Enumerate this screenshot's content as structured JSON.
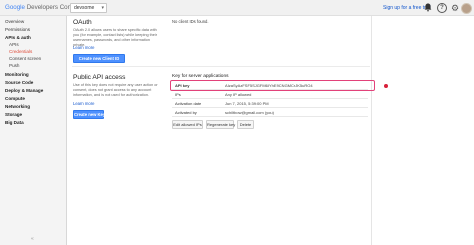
{
  "topbar": {
    "logo": {
      "brand": "Google",
      "product": "Developers Console"
    },
    "project": "devsome",
    "signup": "Sign up for a free trial",
    "icons": [
      "notifications-icon",
      "help-icon",
      "gear-icon",
      "avatar"
    ]
  },
  "sidebar": {
    "items": [
      {
        "label": "Overview"
      },
      {
        "label": "Permissions"
      },
      {
        "label": "APIs & auth"
      },
      {
        "label": "APIs"
      },
      {
        "label": "Credentials"
      },
      {
        "label": "Consent screen"
      },
      {
        "label": "Push"
      },
      {
        "label": "Monitoring"
      },
      {
        "label": "Source Code"
      },
      {
        "label": "Deploy & Manage"
      },
      {
        "label": "Compute"
      },
      {
        "label": "Networking"
      },
      {
        "label": "Storage"
      },
      {
        "label": "Big Data"
      }
    ],
    "collapse_symbol": "«"
  },
  "oauth": {
    "title": "OAuth",
    "desc": "OAuth 2.0 allows users to share specific data with you (for example, contact lists) while keeping their usernames, passwords, and other information private.",
    "learn_more": "Learn more",
    "button": "Create new Client ID",
    "no_clients": "No client IDs found."
  },
  "public_api": {
    "title": "Public API access",
    "desc": "Use of this key does not require any user action or consent, does not grant access to any account information, and is not used for authorization.",
    "learn_more": "Learn more",
    "button": "Create new Key",
    "key_title": "Key for server applications",
    "rows": [
      {
        "label": "API key",
        "value": "AIzaSyAzFSF5SJGFM6IYhE9CNGMCrJK5uRO4"
      },
      {
        "label": "IPs",
        "value": "Any IP allowed"
      },
      {
        "label": "Activation date",
        "value": "Jun 7, 2015, 5:39:00 PM"
      },
      {
        "label": "Activated by",
        "value": "schiltbow@gmail.com (you)"
      }
    ],
    "actions": [
      "Edit allowed IPs",
      "Regenerate key",
      "Delete"
    ]
  }
}
